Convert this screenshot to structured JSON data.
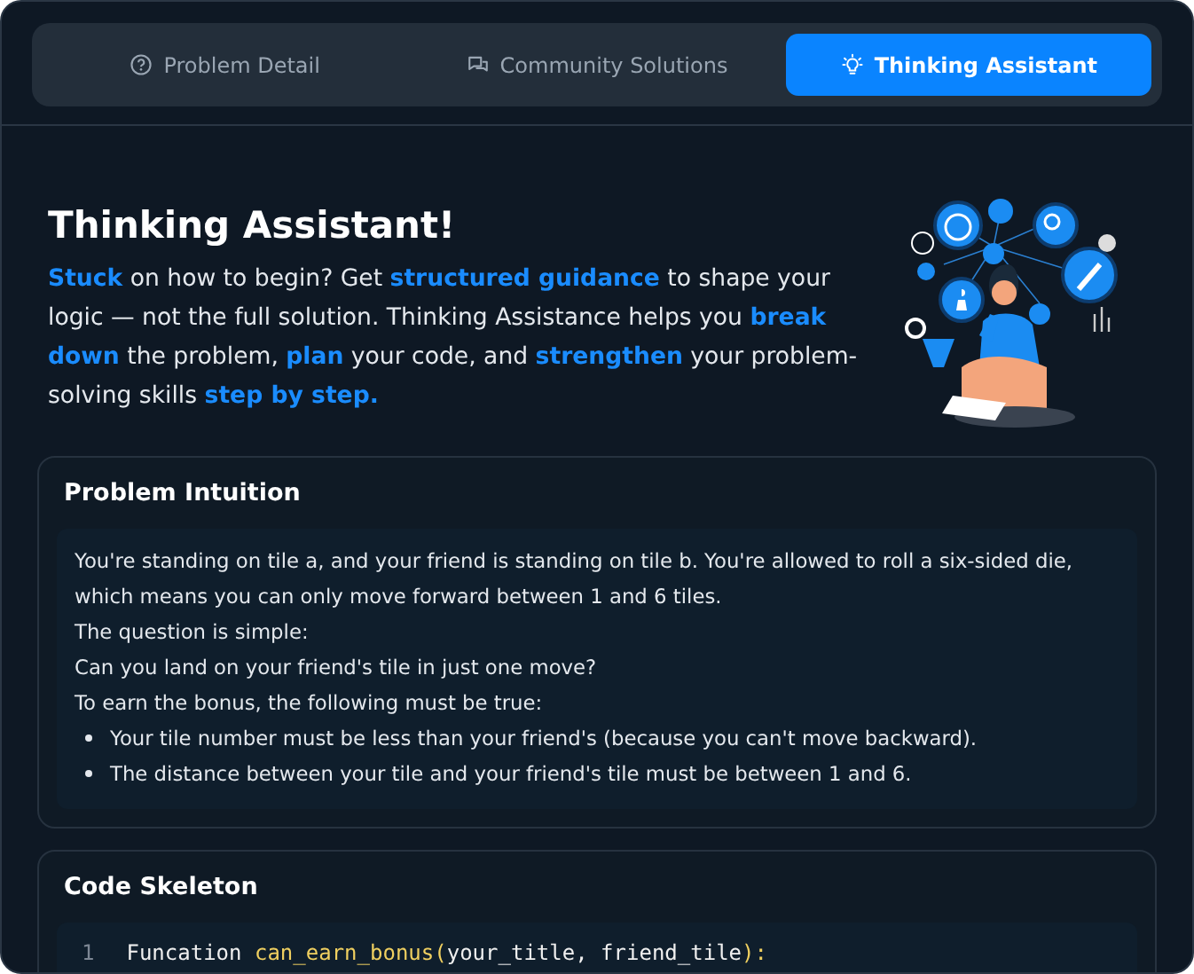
{
  "tabs": [
    {
      "label": "Problem Detail",
      "kind": "question",
      "selected": false
    },
    {
      "label": "Community Solutions",
      "kind": "chat",
      "selected": false
    },
    {
      "label": "Thinking Assistant",
      "kind": "bulb",
      "selected": true
    }
  ],
  "intro": {
    "title": "Thinking Assistant!",
    "text": "**Stuck** on how to begin? Get **structured guidance** to shape your logic — not the full solution. Thinking Assistance helps you **break down** the problem, **plan** your code, and **strengthen** your problem-solving skills **step by step.**"
  },
  "intuition": {
    "title": "Problem Intuition",
    "lines": [
      {
        "kind": "text",
        "text": "You're standing on tile a, and your friend is standing on tile b. You're allowed to roll a six-sided die, which means you can only move forward between 1 and 6 tiles."
      },
      {
        "kind": "text",
        "text": "The question is simple:"
      },
      {
        "kind": "text",
        "text": "Can you land on your friend's tile in just one move?"
      },
      {
        "kind": "text",
        "text": "To earn the bonus, the following must be true:"
      },
      {
        "kind": "bullet",
        "text": "Your tile number must be less than your friend's (because you can't move backward)."
      },
      {
        "kind": "bullet",
        "text": "The distance between your tile and your friend's tile must be between 1 and 6."
      }
    ]
  },
  "skeleton": {
    "title": "Code Skeleton",
    "lines": [
      {
        "number": "1",
        "tokens": [
          {
            "kind": "plain",
            "text": "Funcation "
          },
          {
            "kind": "func",
            "text": "can_earn_bonus("
          },
          {
            "kind": "plain",
            "text": "your_title, friend_tile"
          },
          {
            "kind": "func",
            "text": "):"
          }
        ]
      }
    ]
  }
}
